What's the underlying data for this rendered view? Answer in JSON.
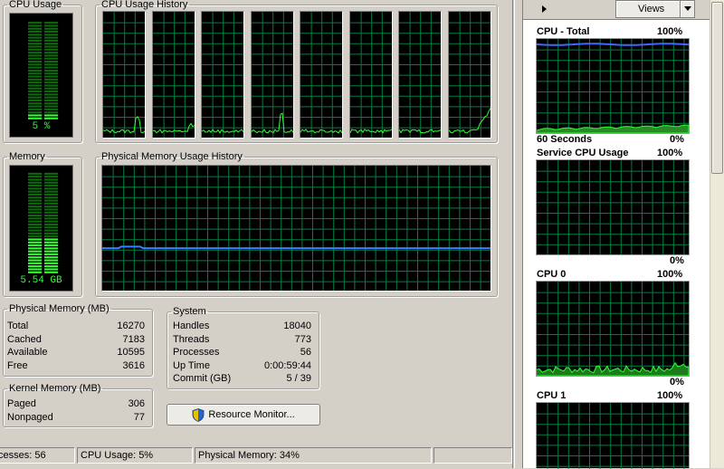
{
  "left": {
    "cpu_usage": {
      "title": "CPU Usage",
      "value": "5 %",
      "level": 0.05
    },
    "cpu_history": {
      "title": "CPU Usage History",
      "cores": 8
    },
    "memory": {
      "title": "Memory",
      "value": "5.54 GB",
      "level": 0.34
    },
    "phys_history": {
      "title": "Physical Memory Usage History"
    },
    "physical_memory": {
      "title": "Physical Memory (MB)",
      "rows": [
        {
          "label": "Total",
          "value": "16270"
        },
        {
          "label": "Cached",
          "value": "7183"
        },
        {
          "label": "Available",
          "value": "10595"
        },
        {
          "label": "Free",
          "value": "3616"
        }
      ]
    },
    "system": {
      "title": "System",
      "rows": [
        {
          "label": "Handles",
          "value": "18040"
        },
        {
          "label": "Threads",
          "value": "773"
        },
        {
          "label": "Processes",
          "value": "56"
        },
        {
          "label": "Up Time",
          "value": "0:00:59:44"
        },
        {
          "label": "Commit (GB)",
          "value": "5 / 39"
        }
      ]
    },
    "kernel_memory": {
      "title": "Kernel Memory (MB)",
      "rows": [
        {
          "label": "Paged",
          "value": "306"
        },
        {
          "label": "Nonpaged",
          "value": "77"
        }
      ]
    },
    "resource_monitor_button": "Resource Monitor..."
  },
  "status_bar": {
    "processes": "cesses: 56",
    "cpu_usage": "CPU Usage: 5%",
    "physical_memory": "Physical Memory: 34%"
  },
  "right": {
    "views_button": "Views",
    "charts": [
      {
        "title": "CPU - Total",
        "max": "100%",
        "bottom_left": "60 Seconds",
        "min": "0%"
      },
      {
        "title": "Service CPU Usage",
        "max": "100%",
        "min": "0%"
      },
      {
        "title": "CPU 0",
        "max": "100%",
        "min": "0%"
      },
      {
        "title": "CPU 1",
        "max": "100%"
      }
    ]
  },
  "colors": {
    "grid": "#008040",
    "cpu_line": "#33ff33",
    "memory_line": "#3a7bff",
    "total_line": "#4466ff"
  }
}
